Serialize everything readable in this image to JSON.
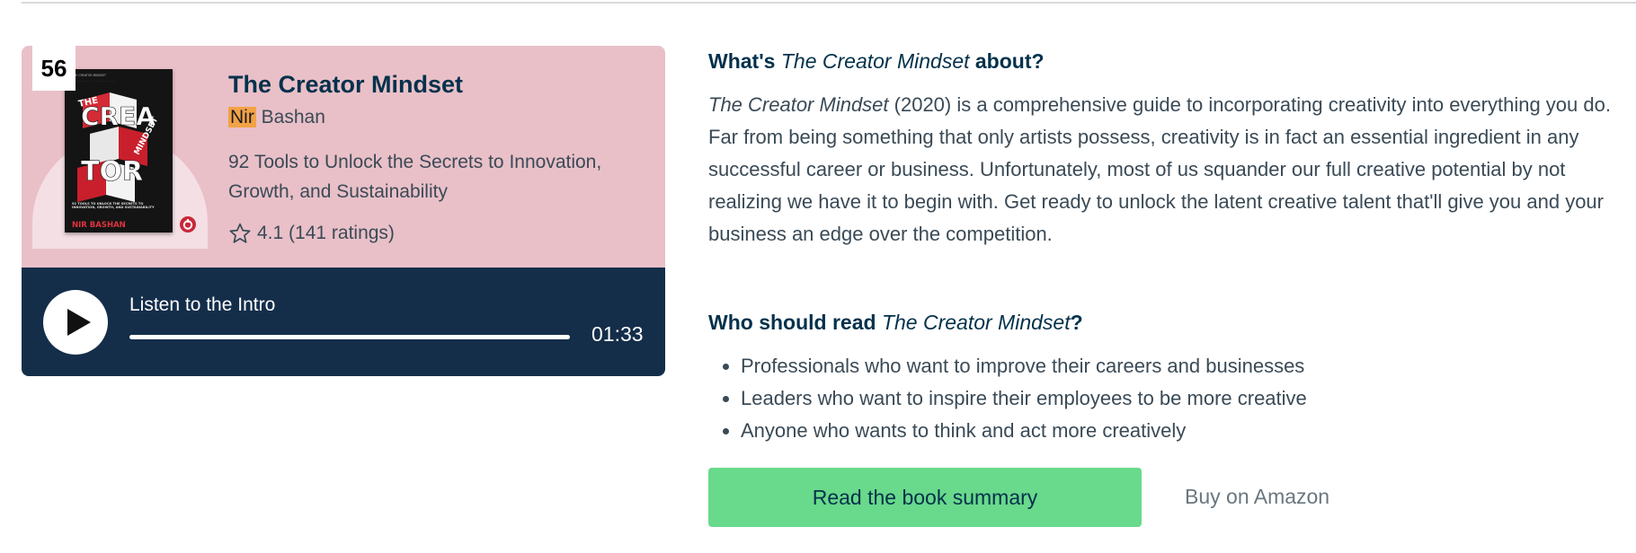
{
  "book": {
    "rank": "56",
    "title": "The Creator Mindset",
    "author_first": "Nir",
    "author_last": "Bashan",
    "subtitle": "92 Tools to Unlock the Secrets to Innovation, Growth, and Sustainability",
    "rating_text": "4.1 (141 ratings)",
    "cover": {
      "blurb_top": "THE CREATOR MINDSET",
      "word_top": "THE",
      "word_main_1": "CREA",
      "word_main_2": "TOR",
      "word_side": "MINDSET",
      "tagline": "92 TOOLS TO UNLOCK THE SECRETS TO INNOVATION, GROWTH, AND SUSTAINABILITY",
      "author": "NIR BASHAN"
    }
  },
  "audio": {
    "label": "Listen to the Intro",
    "duration": "01:33",
    "progress": 0
  },
  "about": {
    "heading_prefix": "What's ",
    "heading_title": "The Creator Mindset",
    "heading_suffix": " about?",
    "para_title": "The Creator Mindset",
    "para_rest": " (2020) is a comprehensive guide to incorporating creativity into everything you do. Far from being something that only artists possess, creativity is in fact an essential ingredient in any successful career or business. Unfortunately, most of us squander our full creative potential by not realizing we have it to begin with. Get ready to unlock the latent creative talent that'll give you and your business an edge over the competition."
  },
  "who": {
    "heading_prefix": "Who should read ",
    "heading_title": "The Creator Mindset",
    "heading_suffix": "?",
    "bullets": [
      "Professionals who want to improve their careers and businesses",
      "Leaders who want to inspire their employees to be more creative",
      "Anyone who wants to think and act more creatively"
    ]
  },
  "actions": {
    "read_label": "Read the book summary",
    "amazon_label": "Buy on Amazon"
  },
  "colors": {
    "card_pink": "#e9c0c8",
    "player_navy": "#142e4a",
    "primary_green": "#69d98b",
    "heading_navy": "#03314b",
    "author_highlight": "#f2a246"
  },
  "icons": {
    "rating": "star-outline-icon",
    "play": "play-icon",
    "cover_badge": "brand-badge-icon"
  }
}
